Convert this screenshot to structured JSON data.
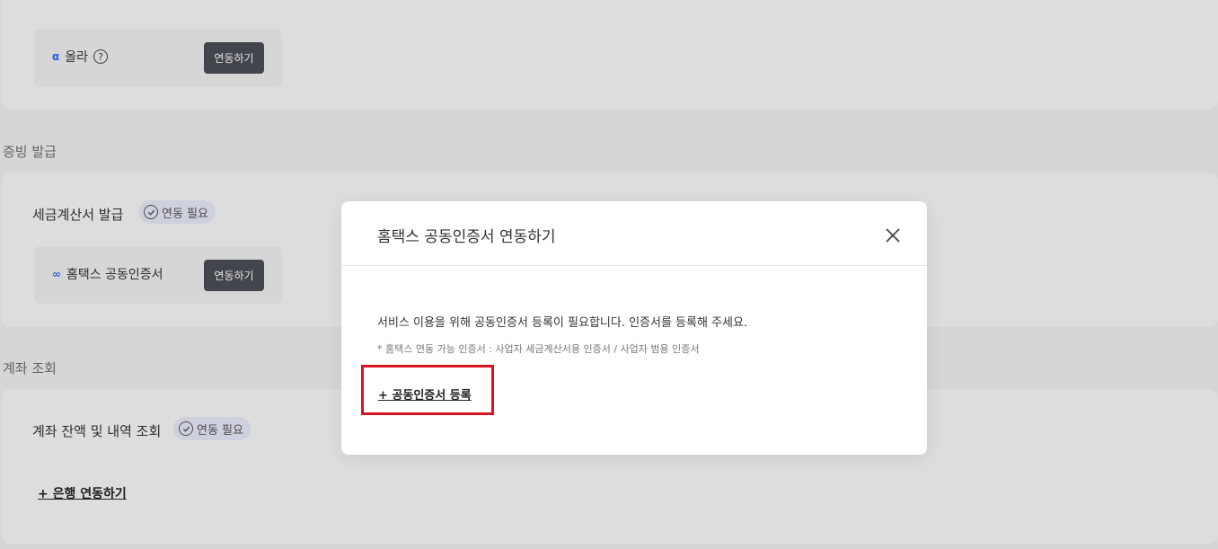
{
  "sections": {
    "issuance_title": "증빙 발급",
    "account_title": "계좌 조회"
  },
  "top_card": {
    "provider": {
      "logo": "α",
      "name": "올라",
      "help": "?"
    },
    "connect_label": "연동하기"
  },
  "tax_invoice": {
    "title": "세금계산서 발급",
    "badge": "연동 필요",
    "provider": {
      "logo": "∞",
      "name": "홈택스 공동인증서"
    },
    "connect_label": "연동하기"
  },
  "account": {
    "title": "계좌 잔액 및 내역 조회",
    "badge": "연동 필요",
    "bank_link": "+ 은행 연동하기"
  },
  "modal": {
    "title": "홈택스 공동인증서 연동하기",
    "description": "서비스 이용을 위해 공동인증서 등록이 필요합니다. 인증서를 등록해 주세요.",
    "note": "* 홈택스 연동 가능 인증서 : 사업자 세금계산서용 인증서 / 사업자 범용 인증서",
    "register_link": "+ 공동인증서 등록"
  },
  "colors": {
    "highlight_border": "#d9141f",
    "dark_button": "#4a4d55",
    "badge_bg": "#e6e8f6"
  }
}
